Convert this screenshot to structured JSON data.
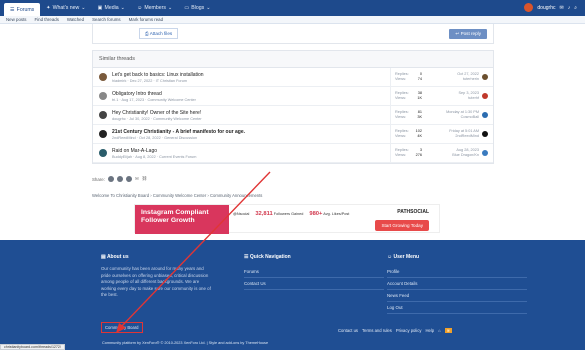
{
  "nav": {
    "tabs": [
      {
        "label": "Forums",
        "active": true
      },
      {
        "label": "What's new"
      },
      {
        "label": "Media"
      },
      {
        "label": "Members"
      },
      {
        "label": "Blogs"
      }
    ],
    "username": "dougrhc",
    "sub": [
      "New posts",
      "Find threads",
      "Watched",
      "Search forums",
      "Mark forums read"
    ]
  },
  "editor": {
    "attach": "Attach files",
    "post": "Post reply"
  },
  "similar": {
    "heading": "Similar threads",
    "rows": [
      {
        "title": "Let's get back to basics: Linux installation",
        "meta": "hiadmirk · Dec 27, 2022 · IT Christian Forum",
        "replies": "0",
        "views": "74",
        "date": "Oct 27, 2022",
        "who": "tuterherin"
      },
      {
        "title": "Obligatory Intro thread",
        "meta": "tri.1 · Aug 17, 2023 · Community Welcome Center",
        "replies": "38",
        "views": "1K",
        "date": "Sep 3, 2023",
        "who": "tuterhf"
      },
      {
        "title": "Hey Christianity! Owner of the Site here!",
        "meta": "dougrhc · Jul 30, 2022 · Community Welcome Center",
        "replies": "81",
        "views": "3K",
        "date": "Monday at 1:30 PM",
        "who": "CosmoBall"
      },
      {
        "title": "21st Century Christianity - A brief manifesto for our age.",
        "meta": "2ndReedMind · Oct 28, 2022 · General Discussion",
        "replies": "102",
        "views": "4K",
        "date": "Friday at 5:01 AM",
        "who": "2ndReedMind"
      },
      {
        "title": "Raid on Mar-A-Lago",
        "meta": "BuddyElijah · Aug 8, 2022 · Current Events Forum",
        "replies": "3",
        "views": "276",
        "date": "Aug 28, 2023",
        "who": "Blue Dragon/Kn"
      }
    ],
    "replies_label": "Replies:",
    "views_label": "Views:"
  },
  "share": "Share:",
  "crumb": "Welcome To Christianity Board  ›  Community Welcome Center  ›  Community Announcements",
  "ad": {
    "headline": "Instagram Compliant Follower Growth",
    "handle": "@Nsocial",
    "followers": "32,811",
    "followers_label": "Followers Gained",
    "likes": "980+",
    "likes_label": "Avg. Likes/Post",
    "brand": "PATHSOCIAL",
    "cta": "Start Growing Today"
  },
  "footer": {
    "about_title": "About us",
    "about_text": "Our community has been around for many years and pride ourselves on offering unbiased, critical discussion among people of all different backgrounds. We are working every day to make sure our community is one of the best.",
    "quick_title": "Quick Navigation",
    "quick_items": [
      "Forums",
      "Contact Us"
    ],
    "user_title": "User Menu",
    "user_items": [
      "Profile",
      "Account Details",
      "News Feed",
      "Log Out"
    ],
    "board_box": "Community Board",
    "links": [
      "Contact us",
      "Terms and rules",
      "Privacy policy",
      "Help"
    ],
    "copyright": "Community platform by XenForo® © 2010-2023 XenForo Ltd. | Style and add-ons by ThemeHouse"
  },
  "status": "christianityboard.com/threads/1272/"
}
